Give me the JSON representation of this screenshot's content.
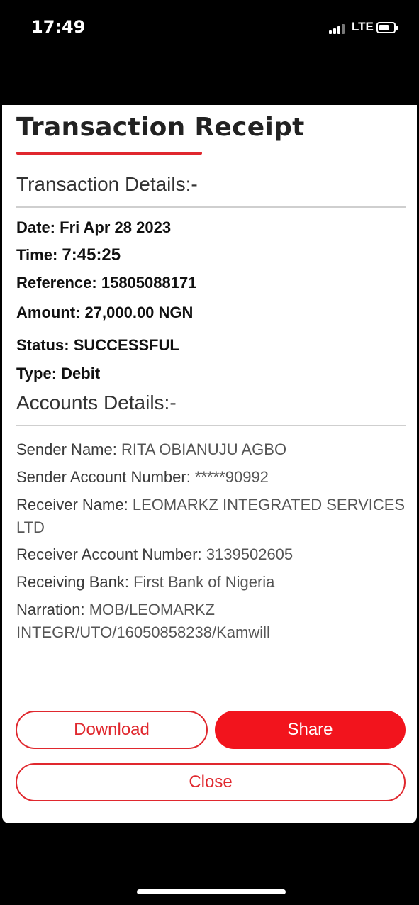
{
  "status_bar": {
    "time": "17:49",
    "network": "LTE",
    "icons": [
      "signal-icon",
      "battery-icon"
    ]
  },
  "receipt": {
    "title": "Transaction Receipt",
    "accent_color": "#e0282e",
    "transaction_section": {
      "title": "Transaction Details:-",
      "rows": [
        {
          "label": "Date:",
          "value": "Fri Apr 28 2023"
        },
        {
          "label": "Time:",
          "value": "7:45:25"
        },
        {
          "label": "Reference:",
          "value": "15805088171"
        },
        {
          "label": "Amount:",
          "value": "27,000.00 NGN"
        },
        {
          "label": "Status:",
          "value": "SUCCESSFUL"
        },
        {
          "label": "Type:",
          "value": "Debit"
        }
      ]
    },
    "accounts_section": {
      "title": "Accounts Details:-",
      "rows": [
        {
          "label": "Sender Name:",
          "value": "RITA OBIANUJU AGBO"
        },
        {
          "label": "Sender Account Number:",
          "value": "*****90992"
        },
        {
          "label": "Receiver Name:",
          "value": "LEOMARKZ INTEGRATED SERVICES LTD"
        },
        {
          "label": "Receiver Account Number:",
          "value": "3139502605"
        },
        {
          "label": "Receiving Bank:",
          "value": "First Bank of Nigeria"
        },
        {
          "label": "Narration:",
          "value": "MOB/LEOMARKZ INTEGR/UTO/16050858238/Kamwill"
        }
      ]
    },
    "actions": {
      "download_label": "Download",
      "share_label": "Share",
      "close_label": "Close"
    }
  }
}
